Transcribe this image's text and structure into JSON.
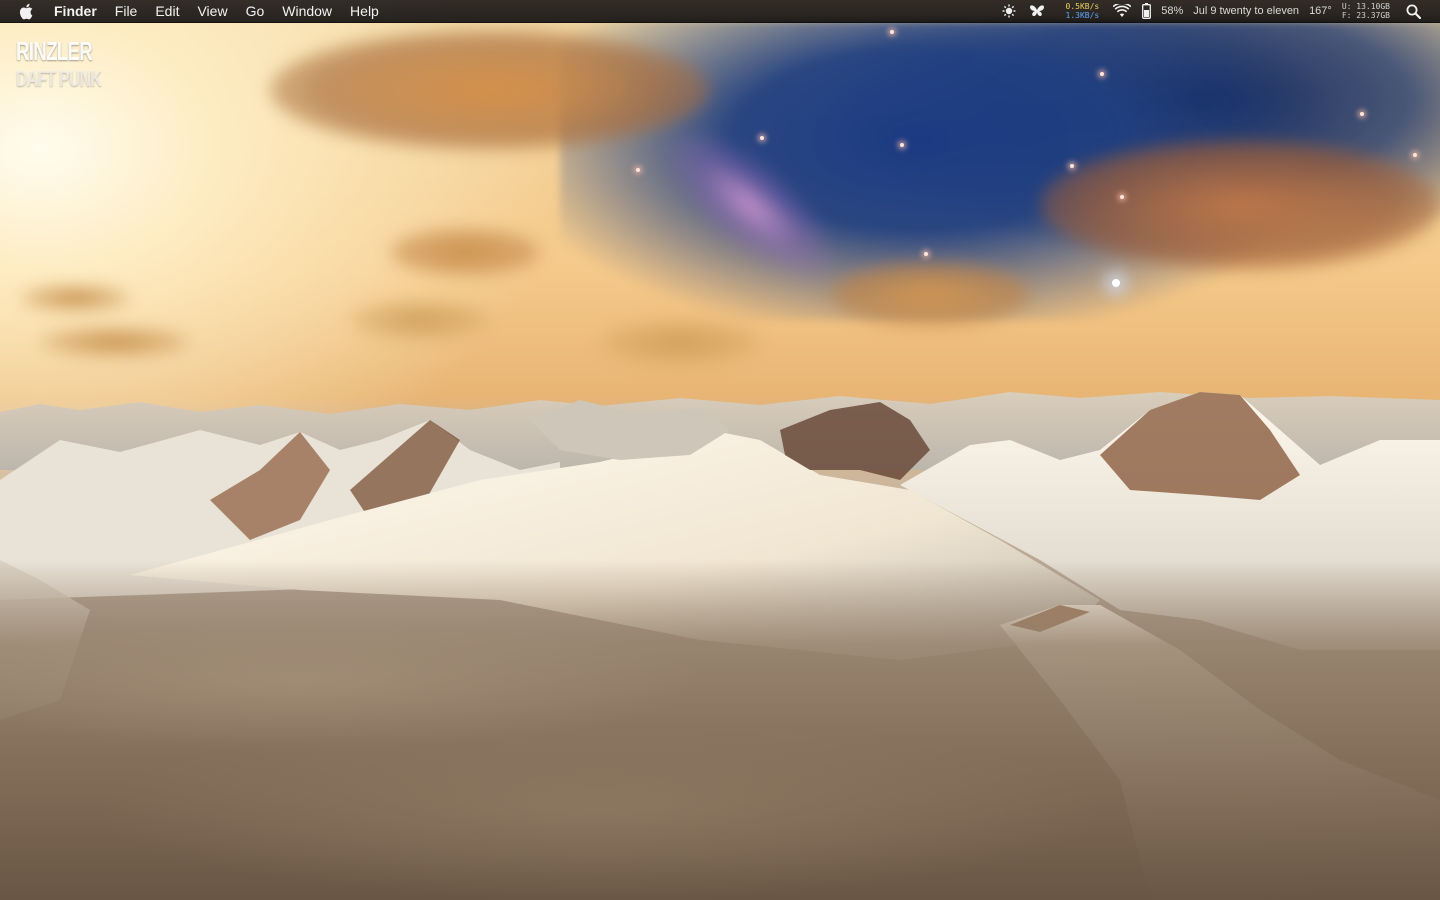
{
  "menubar": {
    "apple_icon": "apple-icon",
    "items": [
      "Finder",
      "File",
      "Edit",
      "View",
      "Go",
      "Window",
      "Help"
    ],
    "status": {
      "brightness_icon": "sun-icon",
      "butterfly_icon": "butterfly-icon",
      "network_up": "0.5KB/s",
      "network_down": "1.3KB/s",
      "wifi_icon": "wifi-icon",
      "battery_icon": "battery-icon",
      "battery_percent": "58%",
      "clock": "Jul 9 twenty to eleven",
      "temperature": "167°",
      "disk_used": "U: 13.10GB",
      "disk_free": "F: 23.37GB",
      "search_icon": "spotlight-search-icon"
    }
  },
  "now_playing": {
    "title": "RINZLER",
    "artist": "DAFT PUNK"
  },
  "colors": {
    "menubar_bg": "#1a1716",
    "menubar_text": "#f2f2f2",
    "network_up": "#e8d060",
    "network_down": "#5aa8ff"
  }
}
